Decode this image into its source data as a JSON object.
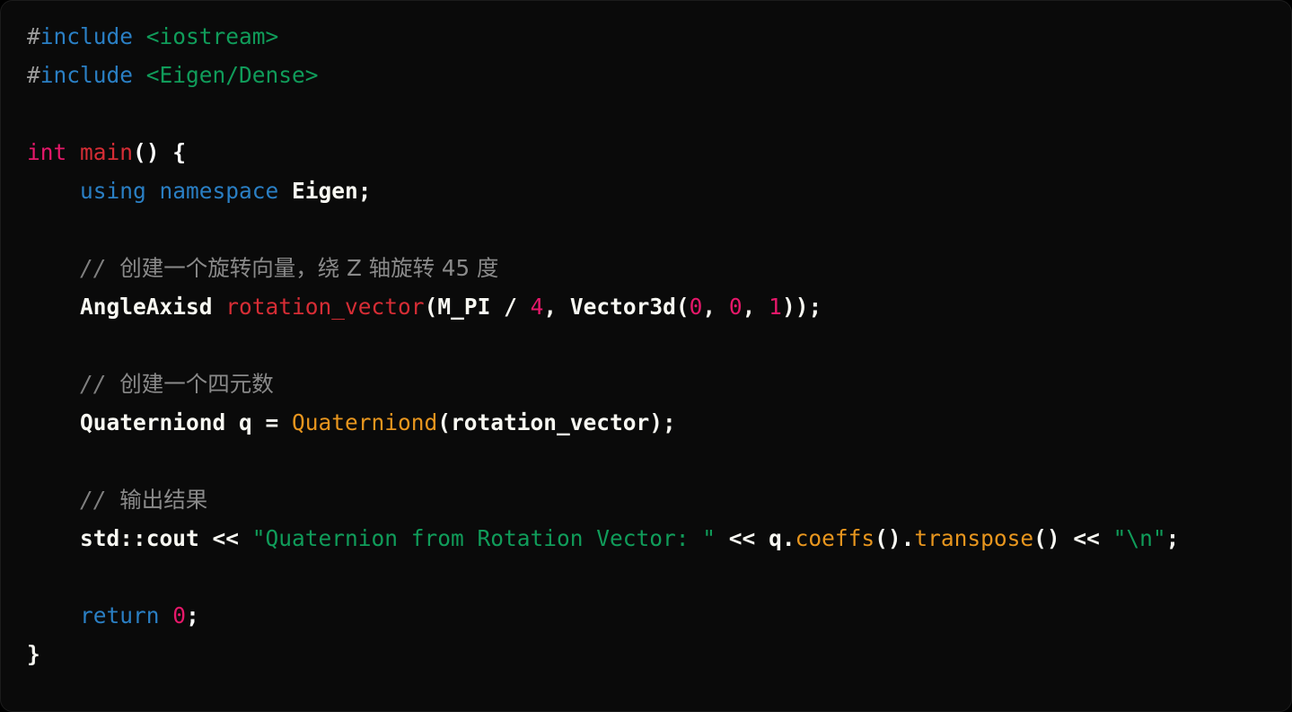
{
  "editor": {
    "language": "cpp",
    "background_color": "#0a0a0a",
    "border_color": "#1c1c1c",
    "theme_colors": {
      "plain": "#f8f8f2",
      "punctuation": "#ffffff",
      "hash": "#9b9b9b",
      "preprocessor": "#2a7fc4",
      "header_name": "#109c5a",
      "keyword": "#2a7fc4",
      "builtin_type": "#e6186a",
      "function_name": "#d62d35",
      "variable": "#d62d35",
      "number": "#e6186a",
      "string": "#109c5a",
      "method_call": "#e8961e",
      "comment": "#7f7f7f"
    }
  },
  "code": {
    "line_01": {
      "hash": "#",
      "directive": "include",
      "space": " ",
      "header": "<iostream>"
    },
    "line_02": {
      "hash": "#",
      "directive": "include",
      "space": " ",
      "header": "<Eigen/Dense>"
    },
    "line_04": {
      "type": "int",
      "space": " ",
      "name": "main",
      "punct": "() {"
    },
    "line_05": {
      "indent": "    ",
      "keyword": "using namespace",
      "space": " ",
      "rest": "Eigen;"
    },
    "line_07": {
      "indent": "    ",
      "slashes": "// ",
      "text": "创建一个旋转向量，绕 Z 轴旋转 45 度"
    },
    "line_08": {
      "indent": "    ",
      "type": "AngleAxisd",
      "space1": " ",
      "var": "rotation_vector",
      "open": "(M_PI / ",
      "num1": "4",
      "mid": ", Vector3d(",
      "num2": "0",
      "comma1": ", ",
      "num3": "0",
      "comma2": ", ",
      "num4": "1",
      "close": "));"
    },
    "line_10": {
      "indent": "    ",
      "slashes": "// ",
      "text": "创建一个四元数"
    },
    "line_11": {
      "indent": "    ",
      "decl": "Quaterniond q = ",
      "call": "Quaterniond",
      "args": "(rotation_vector);"
    },
    "line_13": {
      "indent": "    ",
      "slashes": "// ",
      "text": "输出结果"
    },
    "line_14": {
      "indent": "    ",
      "stream": "std::cout << ",
      "string1": "\"Quaternion from Rotation Vector: \"",
      "op1": " << ",
      "obj": "q.",
      "method1": "coeffs",
      "paren1": "().",
      "method2": "transpose",
      "paren2": "() << ",
      "string2": "\"\\n\"",
      "semi": ";"
    },
    "line_16": {
      "indent": "    ",
      "keyword": "return",
      "space": " ",
      "num": "0",
      "semi": ";"
    },
    "line_17": {
      "brace": "}"
    }
  }
}
